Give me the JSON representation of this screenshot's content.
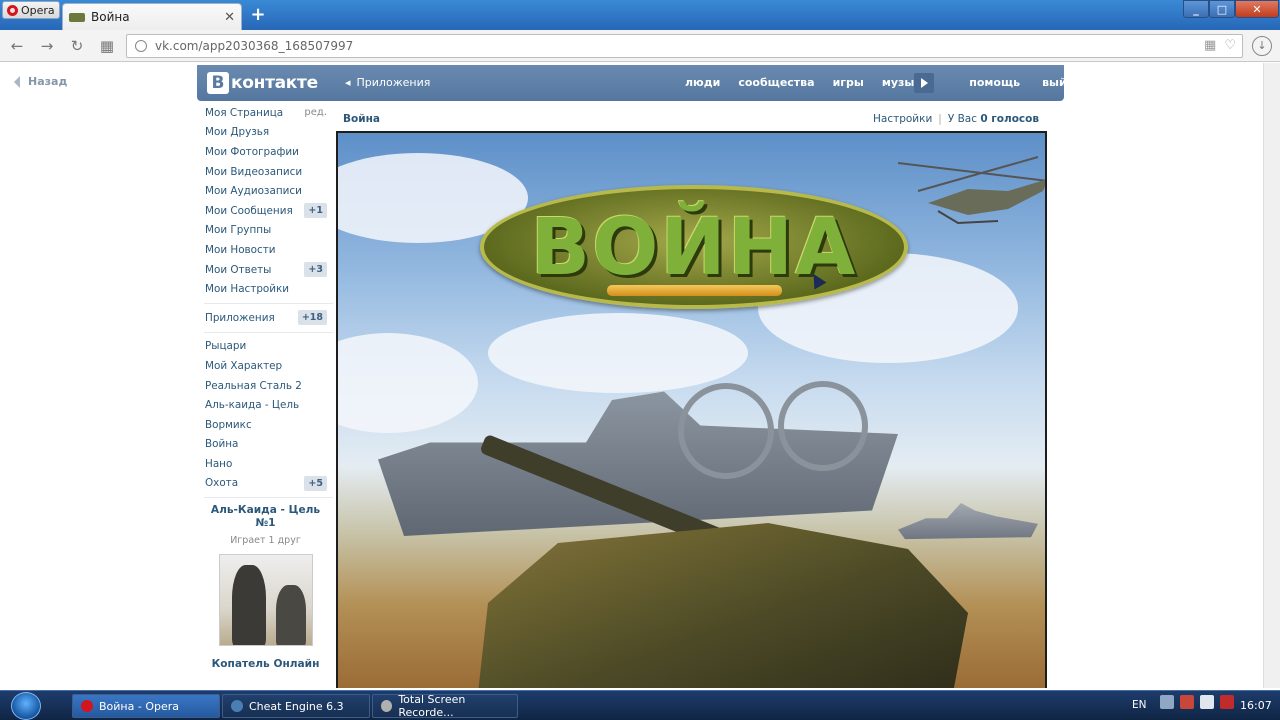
{
  "browser": {
    "menu_label": "Opera",
    "tab_title": "Война",
    "url": "vk.com/app2030368_168507997"
  },
  "page": {
    "back_label": "Назад",
    "logo_b": "В",
    "logo_text": "контакте",
    "apps_label": "Приложения",
    "nav": {
      "people": "люди",
      "communities": "сообщества",
      "games": "игры",
      "music": "музыка",
      "help": "помощь",
      "logout": "выйти"
    },
    "sidebar": {
      "edit_label": "ред.",
      "main_items": [
        {
          "label": "Моя Страница",
          "badge": ""
        },
        {
          "label": "Мои Друзья",
          "badge": ""
        },
        {
          "label": "Мои Фотографии",
          "badge": ""
        },
        {
          "label": "Мои Видеозаписи",
          "badge": ""
        },
        {
          "label": "Мои Аудиозаписи",
          "badge": ""
        },
        {
          "label": "Мои Сообщения",
          "badge": "+1"
        },
        {
          "label": "Мои Группы",
          "badge": ""
        },
        {
          "label": "Мои Новости",
          "badge": ""
        },
        {
          "label": "Мои Ответы",
          "badge": "+3"
        },
        {
          "label": "Мои Настройки",
          "badge": ""
        }
      ],
      "apps_item": {
        "label": "Приложения",
        "badge": "+18"
      },
      "app_items": [
        {
          "label": "Рыцари",
          "badge": ""
        },
        {
          "label": "Мой Характер",
          "badge": ""
        },
        {
          "label": "Реальная Сталь 2",
          "badge": ""
        },
        {
          "label": "Аль-каида - Цель",
          "badge": ""
        },
        {
          "label": "Вормикс",
          "badge": ""
        },
        {
          "label": "Война",
          "badge": ""
        },
        {
          "label": "Нано",
          "badge": ""
        },
        {
          "label": "Охота",
          "badge": "+5"
        }
      ],
      "promo_title": "Аль-Каида - Цель №1",
      "promo_sub": "Играет 1 друг",
      "promo2_title": "Копатель Онлайн"
    },
    "app": {
      "title": "Война",
      "settings": "Настройки",
      "votes_prefix": "У Вас",
      "votes_value": "0 голосов",
      "game_logo": "ВОЙНА"
    }
  },
  "taskbar": {
    "tasks": [
      {
        "label": "Война - Opera"
      },
      {
        "label": "Cheat Engine 6.3"
      },
      {
        "label": "Total Screen Recorde..."
      }
    ],
    "lang": "EN",
    "clock": "16:07"
  },
  "colors": {
    "vk_header": "#5b7aa1",
    "vk_link": "#2b587a",
    "taskbar": "#16335c"
  }
}
